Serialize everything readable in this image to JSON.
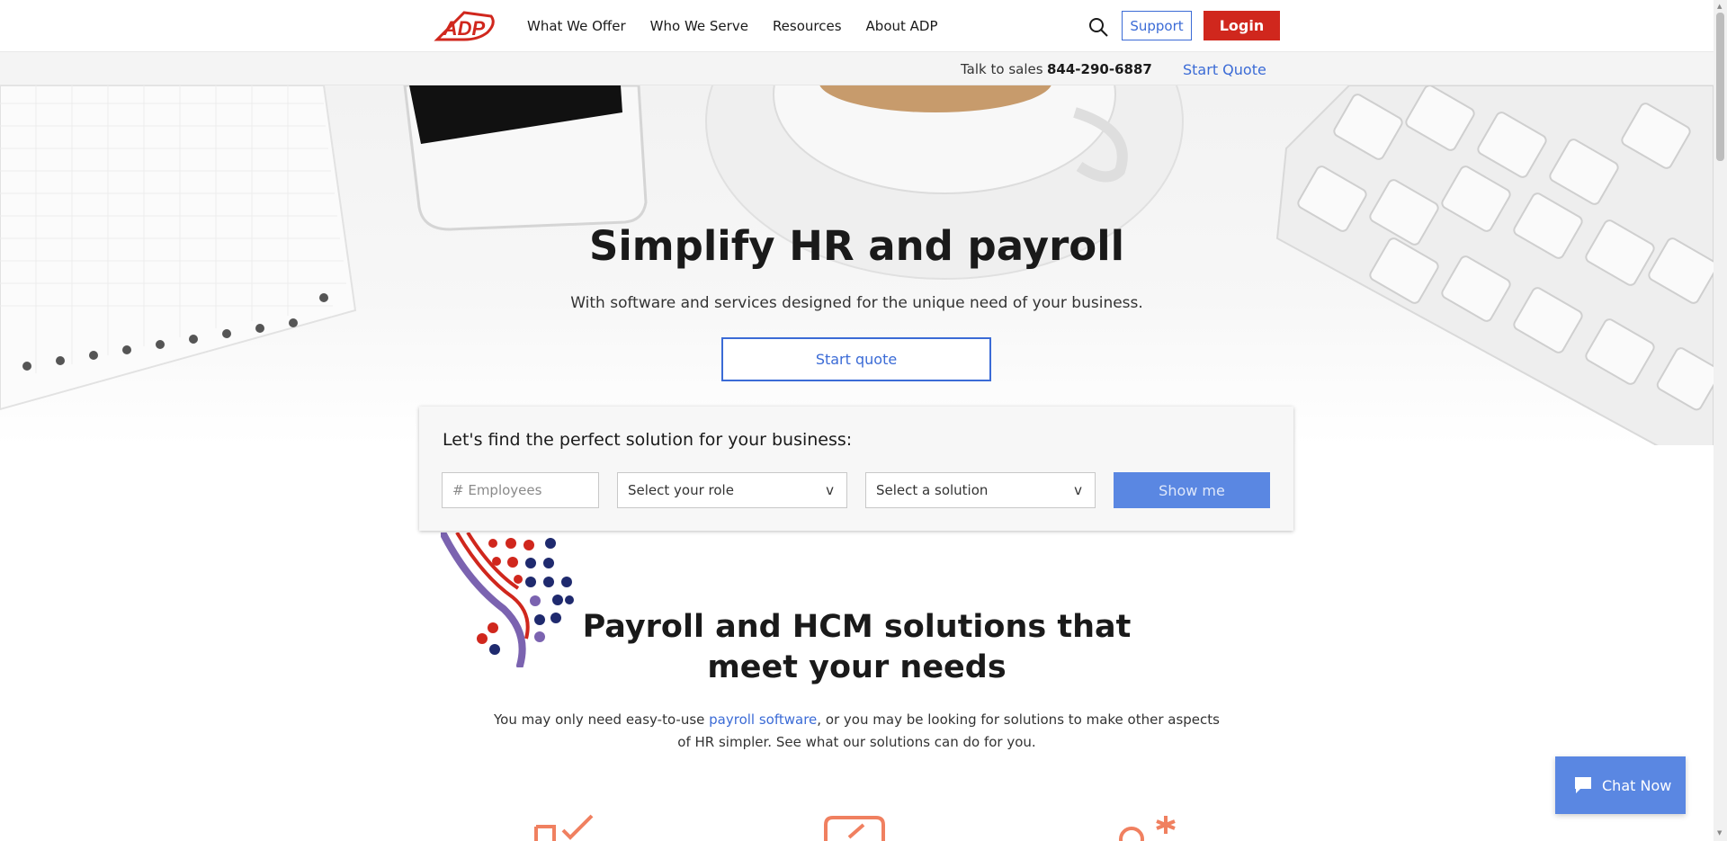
{
  "brand": {
    "logo_text": "ADP"
  },
  "nav": {
    "items": [
      {
        "label": "What We Offer"
      },
      {
        "label": "Who We Serve"
      },
      {
        "label": "Resources"
      },
      {
        "label": "About ADP"
      }
    ],
    "search_icon": "search-icon",
    "support_label": "Support",
    "login_label": "Login"
  },
  "subbar": {
    "talk_label": "Talk to sales",
    "phone": "844-290-6887",
    "start_quote_label": "Start Quote"
  },
  "hero": {
    "title": "Simplify HR and payroll",
    "subtitle": "With software and services designed for the unique need of your business.",
    "cta_label": "Start quote"
  },
  "finder": {
    "title": "Let's find the perfect solution for your business:",
    "employees_placeholder": "# Employees",
    "role_selected": "Select your role",
    "solution_selected": "Select a solution",
    "submit_label": "Show me",
    "chevron": "v"
  },
  "solutions": {
    "title_line1": "Payroll and HCM solutions that",
    "title_line2": "meet your needs",
    "desc_before": "You may only need easy-to-use ",
    "desc_link": "payroll software",
    "desc_after": ", or you may be looking for solutions to make other aspects of HR simpler. See what our solutions can do for you."
  },
  "chat": {
    "label": "Chat Now",
    "icon": "chat-bubble-icon"
  },
  "colors": {
    "brand_red": "#d0271d",
    "link_blue": "#3b6bd6",
    "button_blue": "#5a87e2",
    "accent_orange": "#f08060"
  }
}
